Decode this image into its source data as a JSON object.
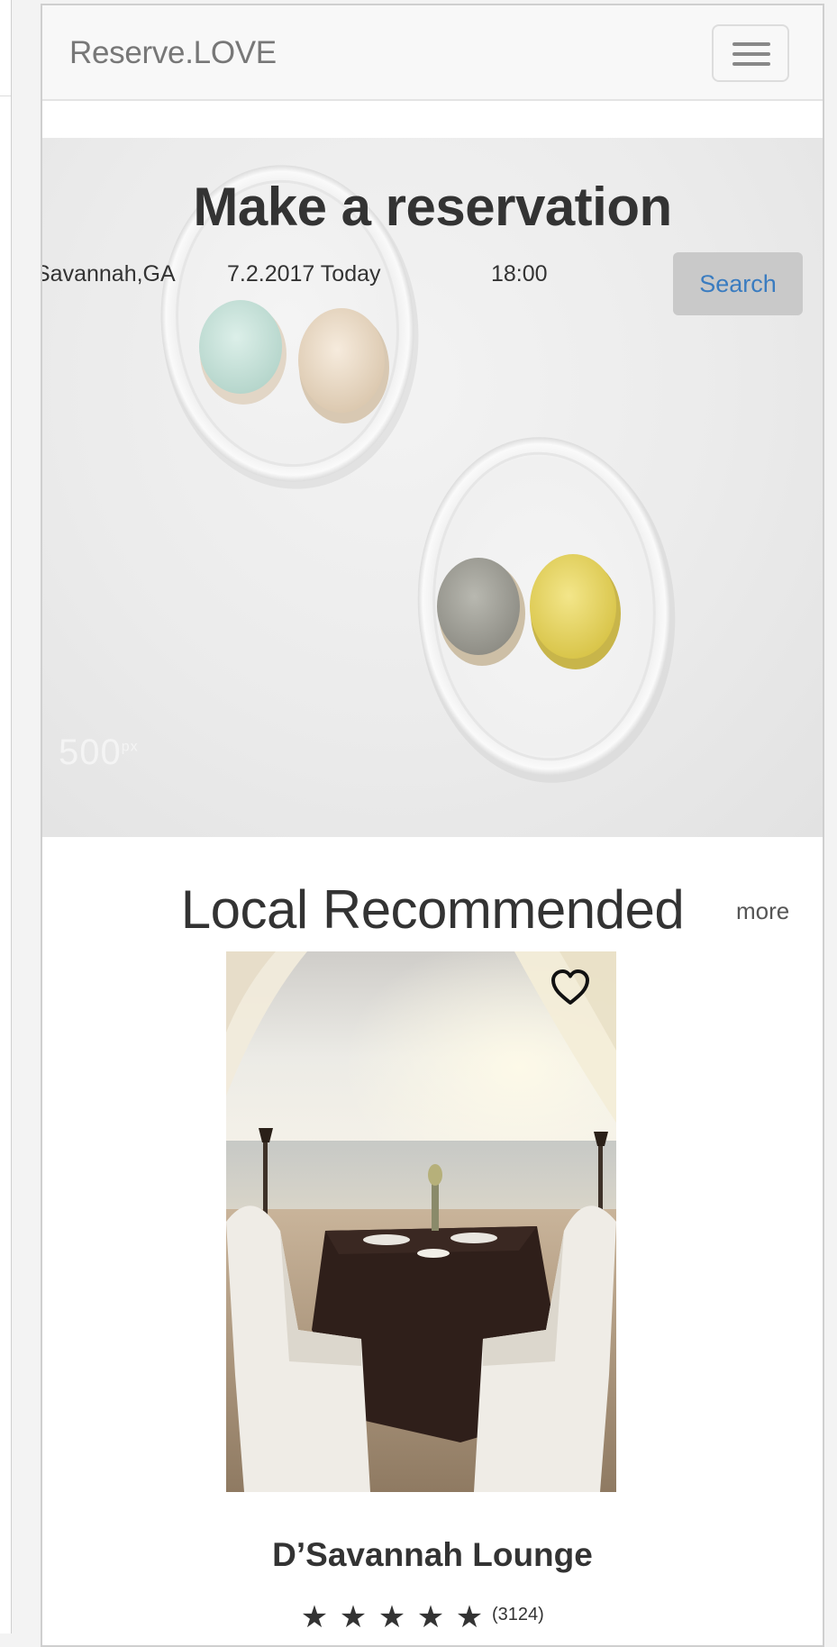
{
  "navbar": {
    "brand": "Reserve.LOVE",
    "menu_icon": "hamburger-menu-icon"
  },
  "hero": {
    "title": "Make a reservation",
    "location_value": "Savannah,GA",
    "date_value": "7.2.2017 Today",
    "time_value": "18:00",
    "search_label": "Search",
    "watermark": "500",
    "watermark_sup": "px"
  },
  "recommended": {
    "title": "Local Recommended",
    "more_label": "more",
    "card": {
      "name": "D’Savannah Lounge",
      "rating": 5,
      "stars": [
        "★",
        "★",
        "★",
        "★",
        "★"
      ],
      "review_count": "(3124)",
      "favorite_icon": "heart-outline-icon"
    }
  },
  "colors": {
    "link_blue": "#3a7cc0",
    "text_dark": "#333333",
    "navbar_bg": "#f8f8f8",
    "button_gray": "#c9c9c9"
  }
}
